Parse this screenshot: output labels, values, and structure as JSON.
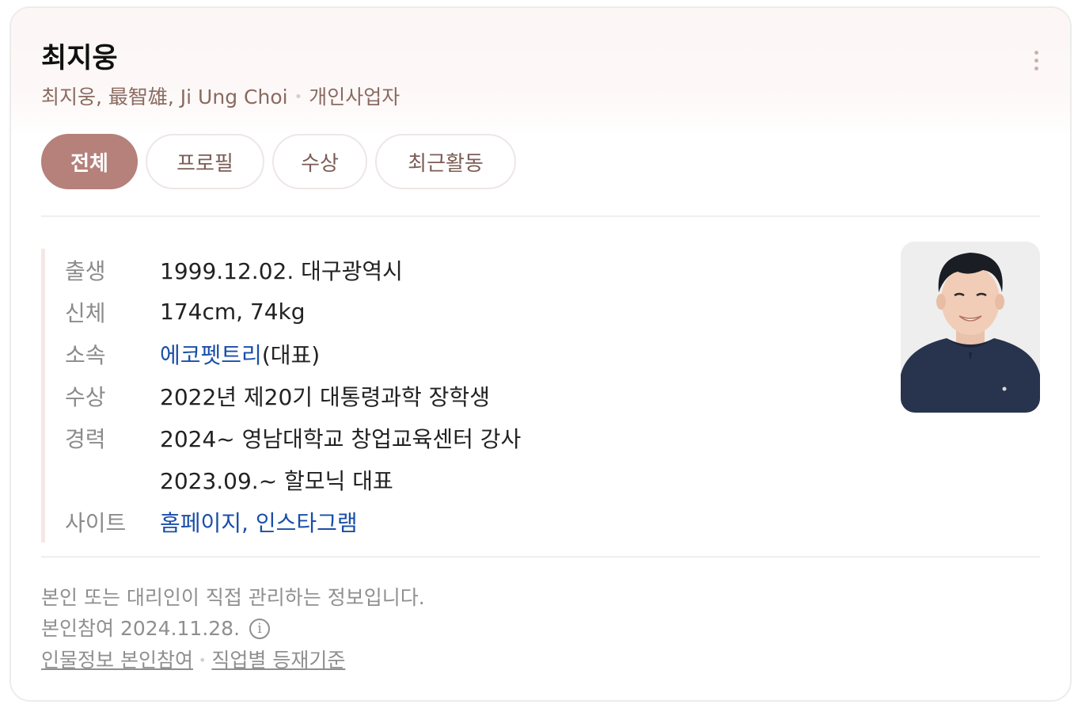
{
  "profile": {
    "name": "최지웅",
    "aliases": "최지웅, 最智雄, Ji Ung Choi",
    "occupation": "개인사업자"
  },
  "tabs": [
    {
      "label": "전체",
      "active": true
    },
    {
      "label": "프로필",
      "active": false
    },
    {
      "label": "수상",
      "active": false
    },
    {
      "label": "최근활동",
      "active": false
    }
  ],
  "info": {
    "birth_label": "출생",
    "birth_value": "1999.12.02. 대구광역시",
    "body_label": "신체",
    "body_value": "174cm, 74kg",
    "affiliation_label": "소속",
    "affiliation_link": "에코펫트리",
    "affiliation_suffix": "(대표)",
    "award_label": "수상",
    "award_value": "2022년 제20기 대통령과학 장학생",
    "career_label": "경력",
    "career_items": [
      "2024~ 영남대학교 창업교육센터 강사",
      "2023.09.~ 할모닉 대표"
    ],
    "site_label": "사이트",
    "site_homepage": "홈페이지",
    "site_separator": ",",
    "site_instagram": "인스타그램"
  },
  "footer": {
    "note": "본인 또는 대리인이 직접 관리하는 정보입니다.",
    "participation_date": "본인참여 2024.11.28.",
    "info_icon_glyph": "i",
    "link_participation": "인물정보 본인참여",
    "link_criteria": "직업별 등재기준"
  },
  "colors": {
    "accent": "#b5817a",
    "link": "#1a4ea8",
    "subtitle": "#8a6a60",
    "muted": "#8f8f8f"
  },
  "icons": {
    "more": "more-vertical-icon",
    "info": "info-circle-icon"
  }
}
